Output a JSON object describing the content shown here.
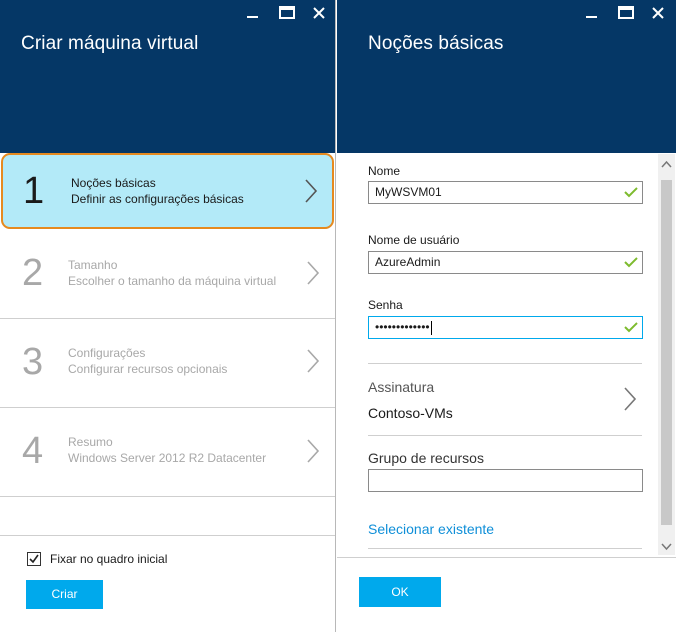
{
  "left_blade": {
    "title": "Criar máquina virtual",
    "steps": [
      {
        "number": "1",
        "title": "Noções básicas",
        "subtitle": "Definir as configurações básicas",
        "active": true
      },
      {
        "number": "2",
        "title": "Tamanho",
        "subtitle": "Escolher o tamanho da máquina virtual",
        "active": false
      },
      {
        "number": "3",
        "title": "Configurações",
        "subtitle": "Configurar recursos opcionais",
        "active": false
      },
      {
        "number": "4",
        "title": "Resumo",
        "subtitle": "Windows Server 2012 R2 Datacenter",
        "active": false
      }
    ],
    "pin_label": "Fixar no quadro inicial",
    "pin_checked": true,
    "create_button": "Criar"
  },
  "right_blade": {
    "title": "Noções básicas",
    "name_label": "Nome",
    "name_value": "MyWSVM01",
    "username_label": "Nome de usuário",
    "username_value": "AzureAdmin",
    "password_label": "Senha",
    "password_value": "•••••••••••••",
    "subscription_label": "Assinatura",
    "subscription_value": "Contoso-VMs",
    "resource_group_label": "Grupo de recursos",
    "resource_group_value": "",
    "select_existing_link": "Selecionar existente",
    "ok_button": "OK"
  },
  "colors": {
    "header_bg": "#053766",
    "active_step_bg": "#b3eaf8",
    "active_step_border": "#e68a1f",
    "accent_blue": "#00a9ec",
    "link_blue": "#0f8fd8",
    "valid_green": "#7dbb2e"
  },
  "icons": {
    "minimize": "minimize-icon",
    "maximize": "maximize-icon",
    "close": "close-icon",
    "chevron": "chevron-right-icon",
    "valid": "checkmark-icon"
  }
}
